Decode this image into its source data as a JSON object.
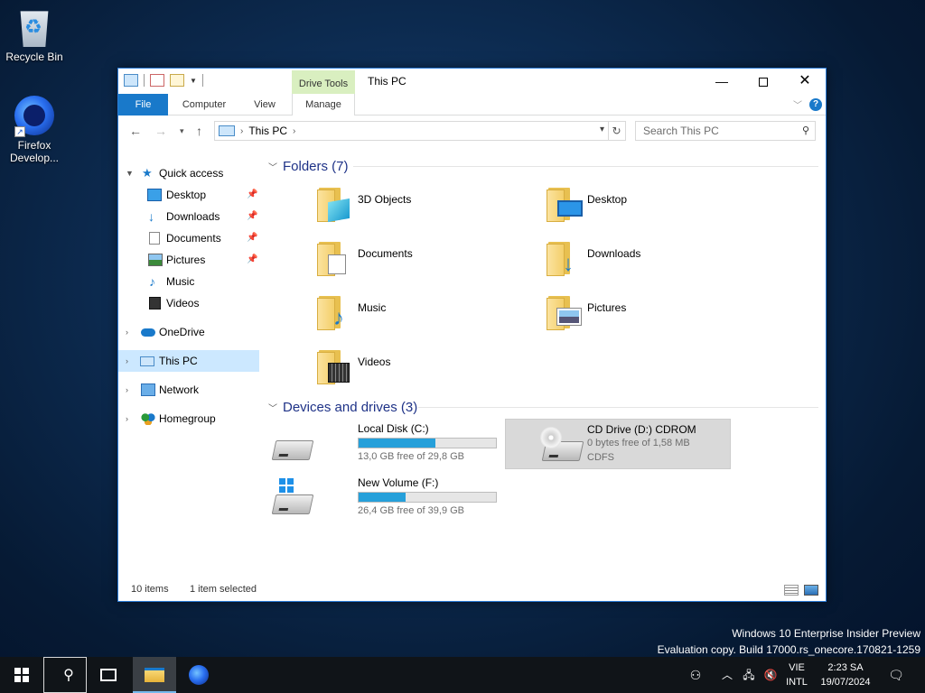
{
  "desktop": {
    "icons": [
      {
        "label": "Recycle Bin"
      },
      {
        "label_line1": "Firefox",
        "label_line2": "Develop..."
      }
    ]
  },
  "window": {
    "title": "This PC",
    "context_tab_group": "Drive Tools",
    "ribbon_tabs": [
      "File",
      "Computer",
      "View",
      "Manage"
    ],
    "address_path": [
      "This PC"
    ],
    "search_placeholder": "Search This PC"
  },
  "nav_pane": {
    "quick_access": "Quick access",
    "quick_items": [
      "Desktop",
      "Downloads",
      "Documents",
      "Pictures",
      "Music",
      "Videos"
    ],
    "roots": [
      "OneDrive",
      "This PC",
      "Network",
      "Homegroup"
    ],
    "selected": "This PC"
  },
  "content": {
    "folders_header": "Folders (7)",
    "folders": [
      "3D Objects",
      "Desktop",
      "Documents",
      "Downloads",
      "Music",
      "Pictures",
      "Videos"
    ],
    "devices_header": "Devices and drives (3)",
    "drives": [
      {
        "name": "Local Disk (C:)",
        "info": "13,0 GB free of 29,8 GB",
        "used_fraction": 0.56
      },
      {
        "name": "CD Drive (D:) CDROM",
        "info": "0 bytes free of 1,58 MB",
        "info2": "CDFS",
        "used_fraction": 1.0
      },
      {
        "name": "New Volume (F:)",
        "info": "26,4 GB free of 39,9 GB",
        "used_fraction": 0.34
      }
    ]
  },
  "status": {
    "items": "10 items",
    "selection": "1 item selected"
  },
  "watermark": {
    "line1": "Windows 10 Enterprise Insider Preview",
    "line2": "Evaluation copy. Build 17000.rs_onecore.170821-1259"
  },
  "taskbar": {
    "lang_line1": "VIE",
    "lang_line2": "INTL",
    "time": "2:23 SA",
    "date": "19/07/2024"
  },
  "colors": {
    "accent": "#1979ca",
    "selection": "#cce8ff",
    "drive_bar": "#26a0da",
    "header_text": "#1e3287"
  }
}
